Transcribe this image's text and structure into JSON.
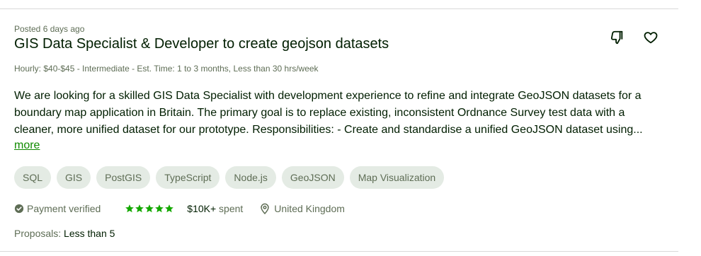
{
  "job": {
    "posted": "Posted 6 days ago",
    "title": "GIS Data Specialist & Developer to create geojson datasets",
    "meta": "Hourly: $40-$45 - Intermediate - Est. Time: 1 to 3 months, Less than 30 hrs/week",
    "description_lines": [
      "We are looking for a skilled GIS Data Specialist with development experience to refine and integrate GeoJSON datasets for a",
      "boundary map application in Britain. The primary goal is to replace existing, inconsistent Ordnance Survey test data with a",
      "cleaner, more unified dataset for our prototype. Responsibilities: - Create and standardise a unified GeoJSON dataset using..."
    ],
    "more_label": "more",
    "tags": [
      "SQL",
      "GIS",
      "PostGIS",
      "TypeScript",
      "Node.js",
      "GeoJSON",
      "Map Visualization"
    ],
    "payment_verified": "Payment verified",
    "rating": 5,
    "spent_amount": "$10K+",
    "spent_suffix": " spent",
    "location": "United Kingdom",
    "proposals_label": "Proposals: ",
    "proposals_value": "Less than 5"
  },
  "icons": {
    "dislike": "thumbs-down-icon",
    "save": "heart-icon",
    "verified": "verified-badge-icon",
    "star": "star-icon",
    "location": "location-pin-icon"
  },
  "colors": {
    "title": "#001e00",
    "muted": "#5e6d55",
    "link": "#108a00",
    "tag_bg": "#e4ebe4",
    "star": "#14a800"
  }
}
